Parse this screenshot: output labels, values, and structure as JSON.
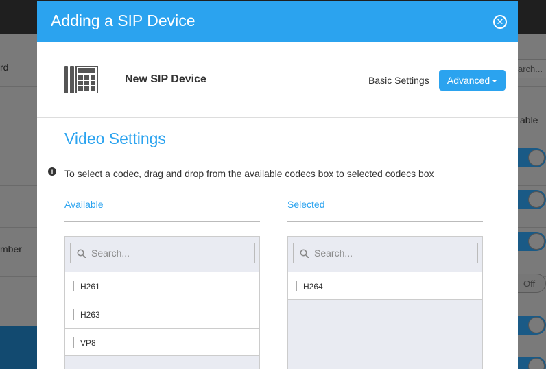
{
  "background": {
    "left_texts": [
      "rd",
      "mber"
    ],
    "search_placeholder": "arch...",
    "column_header_fragment": "able",
    "toggle_off_label": "Off"
  },
  "modal": {
    "title": "Adding a SIP Device",
    "close_icon": "close-circle-icon",
    "device": {
      "icon": "desk-phone-icon",
      "name": "New SIP Device"
    },
    "tabs": {
      "basic_label": "Basic Settings",
      "advanced_label": "Advanced"
    },
    "section_title": "Video Settings",
    "instruction": "To select a codec, drag and drop from the available codecs box to selected codecs box",
    "available": {
      "label": "Available",
      "search_placeholder": "Search...",
      "codecs": [
        "H261",
        "H263",
        "VP8"
      ]
    },
    "selected": {
      "label": "Selected",
      "search_placeholder": "Search...",
      "codecs": [
        "H264"
      ]
    },
    "colors": {
      "accent": "#2ba3ef"
    }
  }
}
